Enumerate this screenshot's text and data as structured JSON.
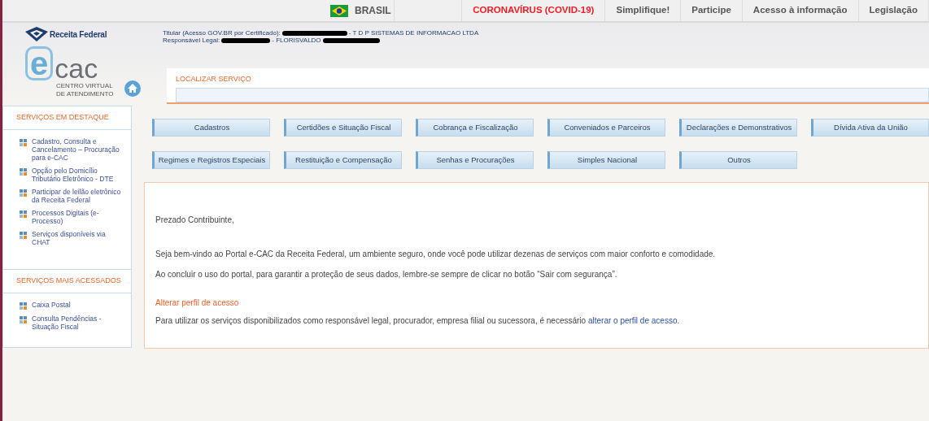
{
  "top_bar": {
    "country": "BRASIL",
    "links": [
      {
        "label": "CORONAVÍRUS (COVID-19)",
        "kind": "alert"
      },
      {
        "label": "Simplifique!",
        "kind": "normal"
      },
      {
        "label": "Participe",
        "kind": "normal"
      },
      {
        "label": "Acesso à informação",
        "kind": "normal"
      },
      {
        "label": "Legislação",
        "kind": "normal"
      }
    ]
  },
  "header": {
    "agency": "Receita Federal",
    "logo_e": "e",
    "logo_cac": "cac",
    "logo_subtitle": [
      "CENTRO VIRTUAL",
      "DE ATENDIMENTO"
    ],
    "user_lines": [
      {
        "label": "Titular (Acesso GOV.BR por Certificado):",
        "value": "- T D P SISTEMAS DE INFORMACAO LTDA"
      },
      {
        "label": "Responsável Legal:",
        "value": "- FLORISVALDO"
      }
    ]
  },
  "search": {
    "label": "LOCALIZAR SERVIÇO"
  },
  "sidebar": {
    "sections": [
      {
        "title": "SERVIÇOS EM DESTAQUE",
        "items": [
          "Cadastro, Consulta e Cancelamento – Procuração para e-CAC",
          "Opção pelo Domicílio Tributário Eletrônico - DTE",
          "Participar de leilão eletrônico da Receita Federal",
          "Processos Digitais (e-Processo)",
          "Serviços disponíveis via CHAT"
        ]
      },
      {
        "title": "SERVIÇOS MAIS ACESSADOS",
        "items": [
          "Caixa Postal",
          "Consulta Pendências - Situação Fiscal"
        ]
      }
    ]
  },
  "categories": [
    [
      "Cadastros",
      "Certidões e Situação Fiscal",
      "Cobrança e Fiscalização",
      "Conveniados e Parceiros",
      "Declarações e Demonstrativos",
      "Dívida Ativa da União"
    ],
    [
      "Regimes e Registros Especiais",
      "Restituição e Compensação",
      "Senhas e Procurações",
      "Simples Nacional",
      "Outros"
    ]
  ],
  "welcome": {
    "greeting": "Prezado Contribuinte,",
    "paragraphs": [
      "Seja bem-vindo ao Portal e-CAC da Receita Federal, um ambiente seguro, onde você pode utilizar dezenas de serviços com maior conforto e comodidade.",
      "Ao concluir o uso do portal, para garantir a proteção de seus dados, lembre-se sempre de clicar no botão “Sair com segurança”."
    ],
    "profile_title": "Alterar perfil de acesso",
    "profile_text": "Para utilizar os serviços disponibilizados como responsável legal, procurador, empresa filial ou sucessora, é necessário",
    "profile_link": "alterar o perfil de acesso."
  }
}
